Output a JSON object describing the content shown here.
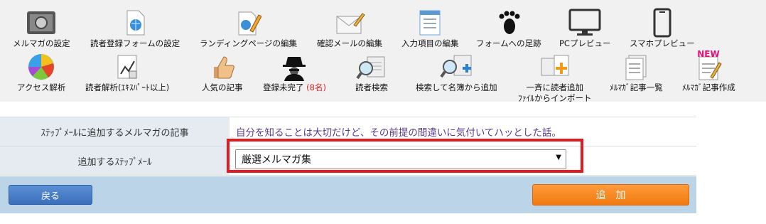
{
  "toolbar": {
    "row1": [
      {
        "label": "メルマガの設定"
      },
      {
        "label": "読者登録フォームの設定"
      },
      {
        "label": "ランディングページの編集"
      },
      {
        "label": "確認メールの編集"
      },
      {
        "label": "入力項目の編集"
      },
      {
        "label": "フォームへの足跡"
      },
      {
        "label": "PCプレビュー"
      },
      {
        "label": "スマホプレビュー"
      }
    ],
    "row2": [
      {
        "label": "アクセス解析"
      },
      {
        "label": "読者解析(ｴｷｽﾊﾟｰﾄ以上)"
      },
      {
        "label": "人気の記事"
      },
      {
        "label": "登録未完了",
        "count": "(8名)"
      },
      {
        "label": "読者検索"
      },
      {
        "label": "検索して名簿から追加"
      },
      {
        "label": "一斉に読者追加",
        "label2": "ﾌｧｲﾙからインポート"
      },
      {
        "label": "ﾒﾙﾏｶﾞ記事一覧"
      },
      {
        "label": "ﾒﾙﾏｶﾞ記事作成",
        "badge": "NEW"
      }
    ]
  },
  "form": {
    "article_label": "ｽﾃｯﾌﾟﾒｰﾙに追加するメルマガの記事",
    "article_value": "自分を知ることは大切だけど、その前提の間違いに気付いてハッとした話。",
    "step_label": "追加するｽﾃｯﾌﾟﾒｰﾙ",
    "step_selected": "厳選メルマガ集"
  },
  "actions": {
    "back": "戻る",
    "add": "追加"
  },
  "colors": {
    "highlight": "#e21b23",
    "back_button": "#3a6fbc",
    "add_button": "#f07a10",
    "action_bar": "#bcd4e8"
  }
}
